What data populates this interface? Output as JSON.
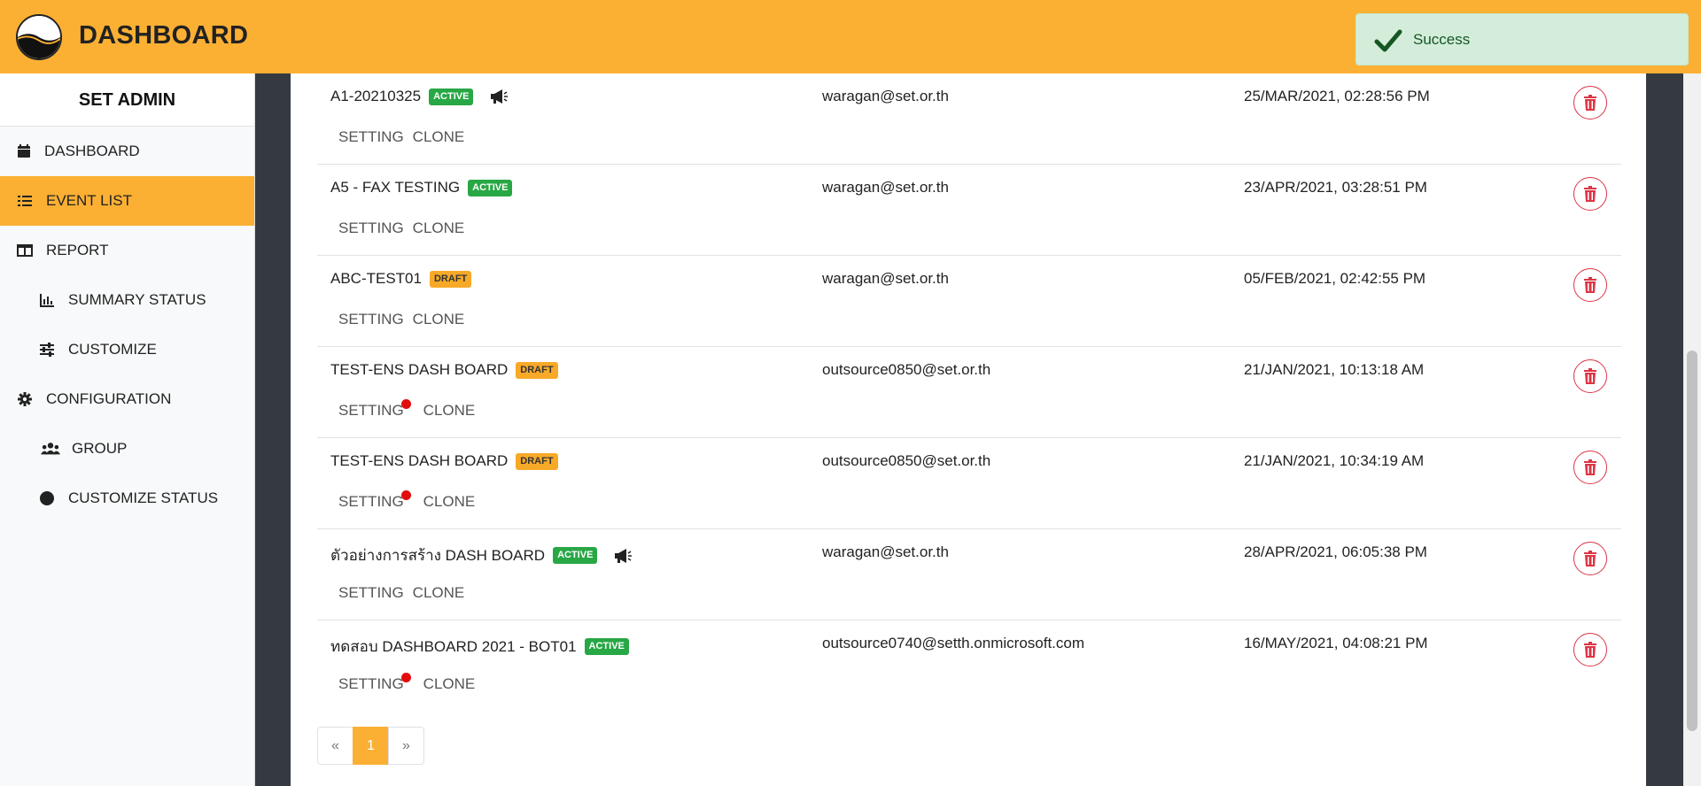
{
  "app": {
    "title": "DASHBOARD"
  },
  "toast": {
    "message": "Success"
  },
  "sidebar": {
    "title": "SET ADMIN",
    "items": [
      {
        "label": "DASHBOARD",
        "icon": "calendar-icon"
      },
      {
        "label": "EVENT LIST",
        "icon": "list-icon",
        "active": true
      },
      {
        "label": "REPORT",
        "icon": "table-icon"
      },
      {
        "label": "SUMMARY STATUS",
        "icon": "bar-chart-icon"
      },
      {
        "label": "CUSTOMIZE",
        "icon": "sliders-icon"
      },
      {
        "label": "CONFIGURATION",
        "icon": "gear-icon"
      },
      {
        "label": "GROUP",
        "icon": "users-icon"
      },
      {
        "label": "CUSTOMIZE STATUS",
        "icon": "circle-icon"
      }
    ]
  },
  "events": [
    {
      "name": "A1-20210325",
      "status": "ACTIVE",
      "announce": true,
      "email": "waragan@set.or.th",
      "date": "25/MAR/2021, 02:28:56 PM",
      "setting": "SETTING",
      "clone": "CLONE",
      "dot": false
    },
    {
      "name": "A5 - FAX TESTING",
      "status": "ACTIVE",
      "announce": false,
      "email": "waragan@set.or.th",
      "date": "23/APR/2021, 03:28:51 PM",
      "setting": "SETTING",
      "clone": "CLONE",
      "dot": false
    },
    {
      "name": "ABC-TEST01",
      "status": "DRAFT",
      "announce": false,
      "email": "waragan@set.or.th",
      "date": "05/FEB/2021, 02:42:55 PM",
      "setting": "SETTING",
      "clone": "CLONE",
      "dot": false
    },
    {
      "name": "TEST-ENS DASH BOARD",
      "status": "DRAFT",
      "announce": false,
      "email": "outsource0850@set.or.th",
      "date": "21/JAN/2021, 10:13:18 AM",
      "setting": "SETTING",
      "clone": "CLONE",
      "dot": true
    },
    {
      "name": "TEST-ENS DASH BOARD",
      "status": "DRAFT",
      "announce": false,
      "email": "outsource0850@set.or.th",
      "date": "21/JAN/2021, 10:34:19 AM",
      "setting": "SETTING",
      "clone": "CLONE",
      "dot": true
    },
    {
      "name": "ตัวอย่างการสร้าง DASH BOARD",
      "status": "ACTIVE",
      "announce": true,
      "email": "waragan@set.or.th",
      "date": "28/APR/2021, 06:05:38 PM",
      "setting": "SETTING",
      "clone": "CLONE",
      "dot": false
    },
    {
      "name": "ทดสอบ DASHBOARD 2021 - BOT01",
      "status": "ACTIVE",
      "announce": false,
      "email": "outsource0740@setth.onmicrosoft.com",
      "date": "16/MAY/2021, 04:08:21 PM",
      "setting": "SETTING",
      "clone": "CLONE",
      "dot": true
    }
  ],
  "pagination": {
    "prev": "«",
    "current": "1",
    "next": "»"
  },
  "colors": {
    "accent": "#fbb034",
    "active_badge": "#28a745",
    "danger": "#dc3545",
    "toast_bg": "#d4edda"
  }
}
